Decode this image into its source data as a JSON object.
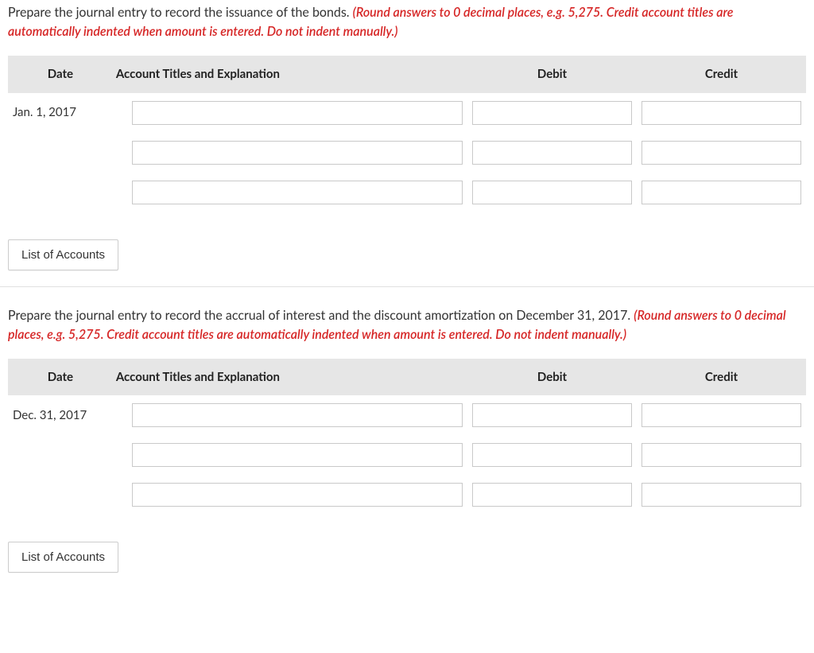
{
  "sections": [
    {
      "instruction_prefix": "Prepare the journal entry to record the issuance of the bonds. ",
      "instruction_red": "(Round answers to 0 decimal places, e.g. 5,275. Credit account titles are automatically indented when amount is entered. Do not indent manually.)",
      "headers": {
        "date": "Date",
        "acct": "Account Titles and Explanation",
        "debit": "Debit",
        "credit": "Credit"
      },
      "rows": [
        {
          "date": "Jan. 1, 2017",
          "acct": "",
          "debit": "",
          "credit": ""
        },
        {
          "date": "",
          "acct": "",
          "debit": "",
          "credit": ""
        },
        {
          "date": "",
          "acct": "",
          "debit": "",
          "credit": ""
        }
      ],
      "button": "List of Accounts"
    },
    {
      "instruction_prefix": "Prepare the journal entry to record the accrual of interest and the discount amortization on December 31, 2017. ",
      "instruction_red": "(Round answers to 0 decimal places, e.g. 5,275. Credit account titles are automatically indented when amount is entered. Do not indent manually.)",
      "headers": {
        "date": "Date",
        "acct": "Account Titles and Explanation",
        "debit": "Debit",
        "credit": "Credit"
      },
      "rows": [
        {
          "date": "Dec. 31, 2017",
          "acct": "",
          "debit": "",
          "credit": ""
        },
        {
          "date": "",
          "acct": "",
          "debit": "",
          "credit": ""
        },
        {
          "date": "",
          "acct": "",
          "debit": "",
          "credit": ""
        }
      ],
      "button": "List of Accounts"
    }
  ]
}
